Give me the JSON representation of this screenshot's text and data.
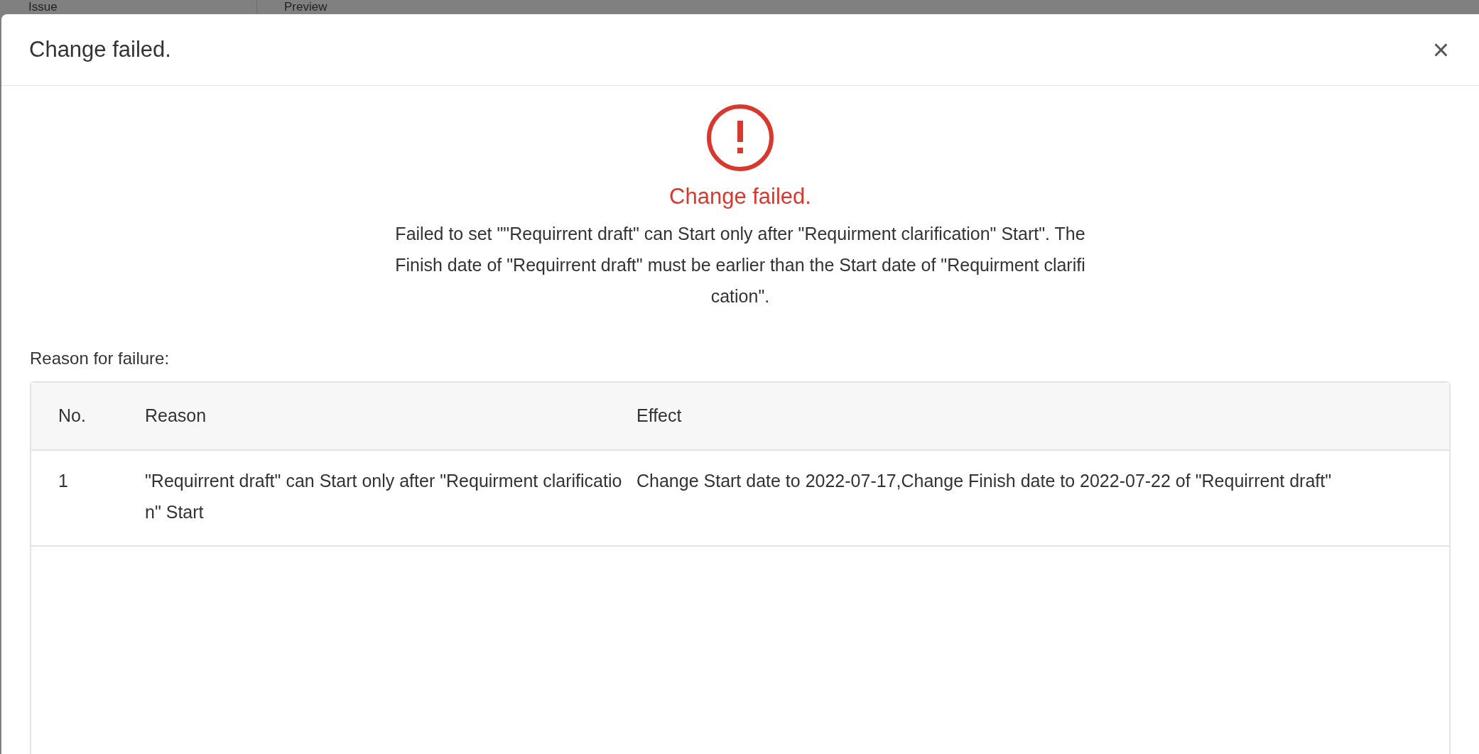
{
  "backdrop": {
    "columns": [
      "Issue",
      "Preview"
    ]
  },
  "dialog": {
    "title": "Change failed.",
    "close": "×",
    "status": {
      "kind": "error",
      "heading": "Change failed.",
      "message": "Failed to set \"\"Requirrent draft\" can Start only after \"Requirment clarification\" Start\". The Finish date of \"Requirrent draft\" must be earlier than the Start date of \"Requirment clarification\"."
    },
    "table_label": "Reason for failure:",
    "table": {
      "columns": [
        "No.",
        "Reason",
        "Effect"
      ],
      "rows": [
        [
          "1",
          "\"Requirrent draft\" can Start only after \"Requirment clarification\" Start",
          "Change Start date to 2022-07-17,Change Finish date to 2022-07-22 of \"Requirrent draft\""
        ]
      ]
    }
  }
}
